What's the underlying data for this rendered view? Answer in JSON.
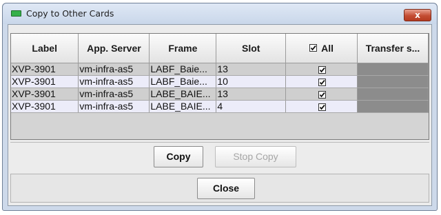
{
  "window": {
    "title": "Copy to Other Cards",
    "close_glyph": "x",
    "app_icon": "green-card-icon",
    "accent_color": "#35b04a",
    "close_color": "#c44d33"
  },
  "table": {
    "headers": {
      "label": "Label",
      "app_server": "App. Server",
      "frame": "Frame",
      "slot": "Slot",
      "all": "All",
      "transfer": "Transfer s..."
    },
    "all_checked": true,
    "rows": [
      {
        "label": "XVP-3901",
        "app_server": "vm-infra-as5",
        "frame": "LABF_Baie...",
        "slot": "13",
        "checked": true
      },
      {
        "label": "XVP-3901",
        "app_server": "vm-infra-as5",
        "frame": "LABF_Baie...",
        "slot": "10",
        "checked": true
      },
      {
        "label": "XVP-3901",
        "app_server": "vm-infra-as5",
        "frame": "LABE_BAIE...",
        "slot": "13",
        "checked": true
      },
      {
        "label": "XVP-3901",
        "app_server": "vm-infra-as5",
        "frame": "LABE_BAIE...",
        "slot": "4",
        "checked": true
      }
    ]
  },
  "buttons": {
    "copy": "Copy",
    "stop_copy": "Stop Copy",
    "close": "Close"
  }
}
